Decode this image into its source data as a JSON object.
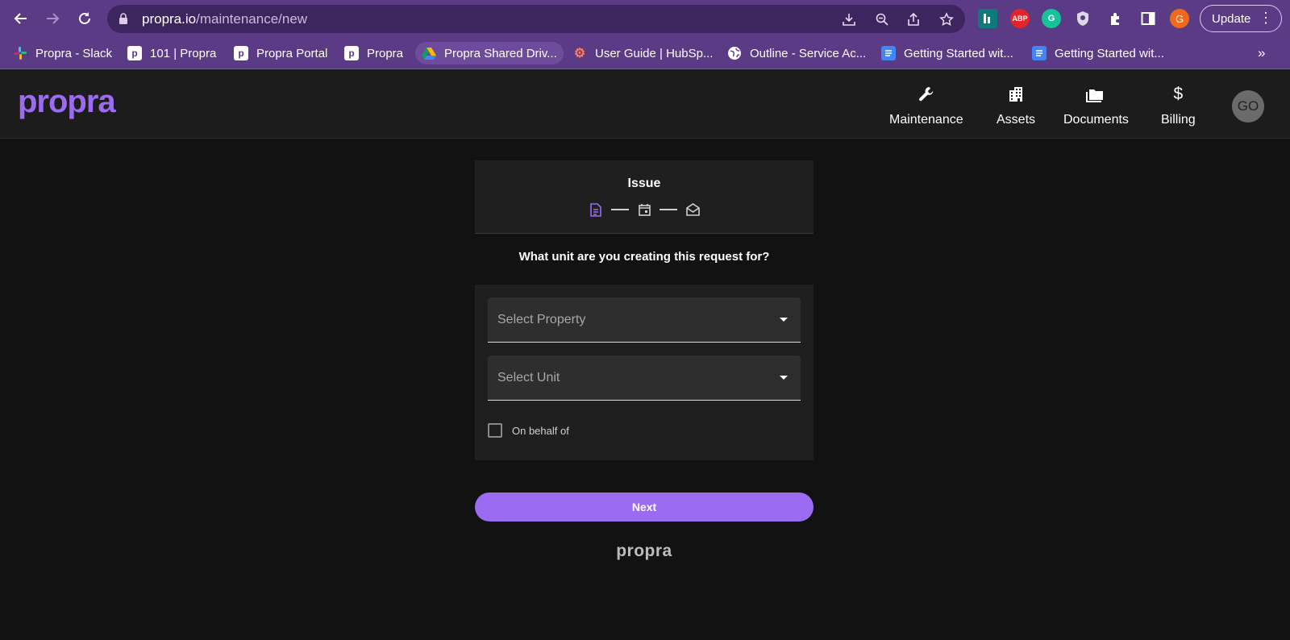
{
  "browser": {
    "url_host": "propra.io",
    "url_path": "/maintenance/new",
    "update_label": "Update",
    "avatar_letter": "G",
    "ext_abp": "ABP",
    "ext_grammarly": "G",
    "icons": [
      "back-icon",
      "forward-icon",
      "reload-icon",
      "lock-icon",
      "install-icon",
      "zoom-icon",
      "share-icon",
      "star-icon",
      "extensions-icon",
      "sidepanel-icon",
      "kebab-icon"
    ]
  },
  "bookmarks": [
    {
      "label": "Propra - Slack"
    },
    {
      "label": "101 | Propra"
    },
    {
      "label": "Propra Portal"
    },
    {
      "label": "Propra"
    },
    {
      "label": "Propra Shared Driv..."
    },
    {
      "label": "User Guide | HubSp..."
    },
    {
      "label": "Outline - Service Ac..."
    },
    {
      "label": "Getting Started wit..."
    },
    {
      "label": "Getting Started wit..."
    }
  ],
  "bookmarks_more": "»",
  "app": {
    "logo": "propra",
    "nav": [
      {
        "label": "Maintenance",
        "icon": "wrench-icon"
      },
      {
        "label": "Assets",
        "icon": "building-icon"
      },
      {
        "label": "Documents",
        "icon": "folder-icon"
      },
      {
        "label": "Billing",
        "icon": "dollar-icon"
      }
    ],
    "avatar": "GO"
  },
  "form": {
    "step_title": "Issue",
    "question": "What unit are you creating this request for?",
    "property_placeholder": "Select Property",
    "unit_placeholder": "Select Unit",
    "on_behalf_label": "On behalf of",
    "on_behalf_checked": false,
    "next_label": "Next",
    "footer_logo": "propra"
  },
  "colors": {
    "accent": "#9b6cf2",
    "browser_purple": "#5b3a86",
    "background": "#121212",
    "card": "#1f1f1f"
  }
}
